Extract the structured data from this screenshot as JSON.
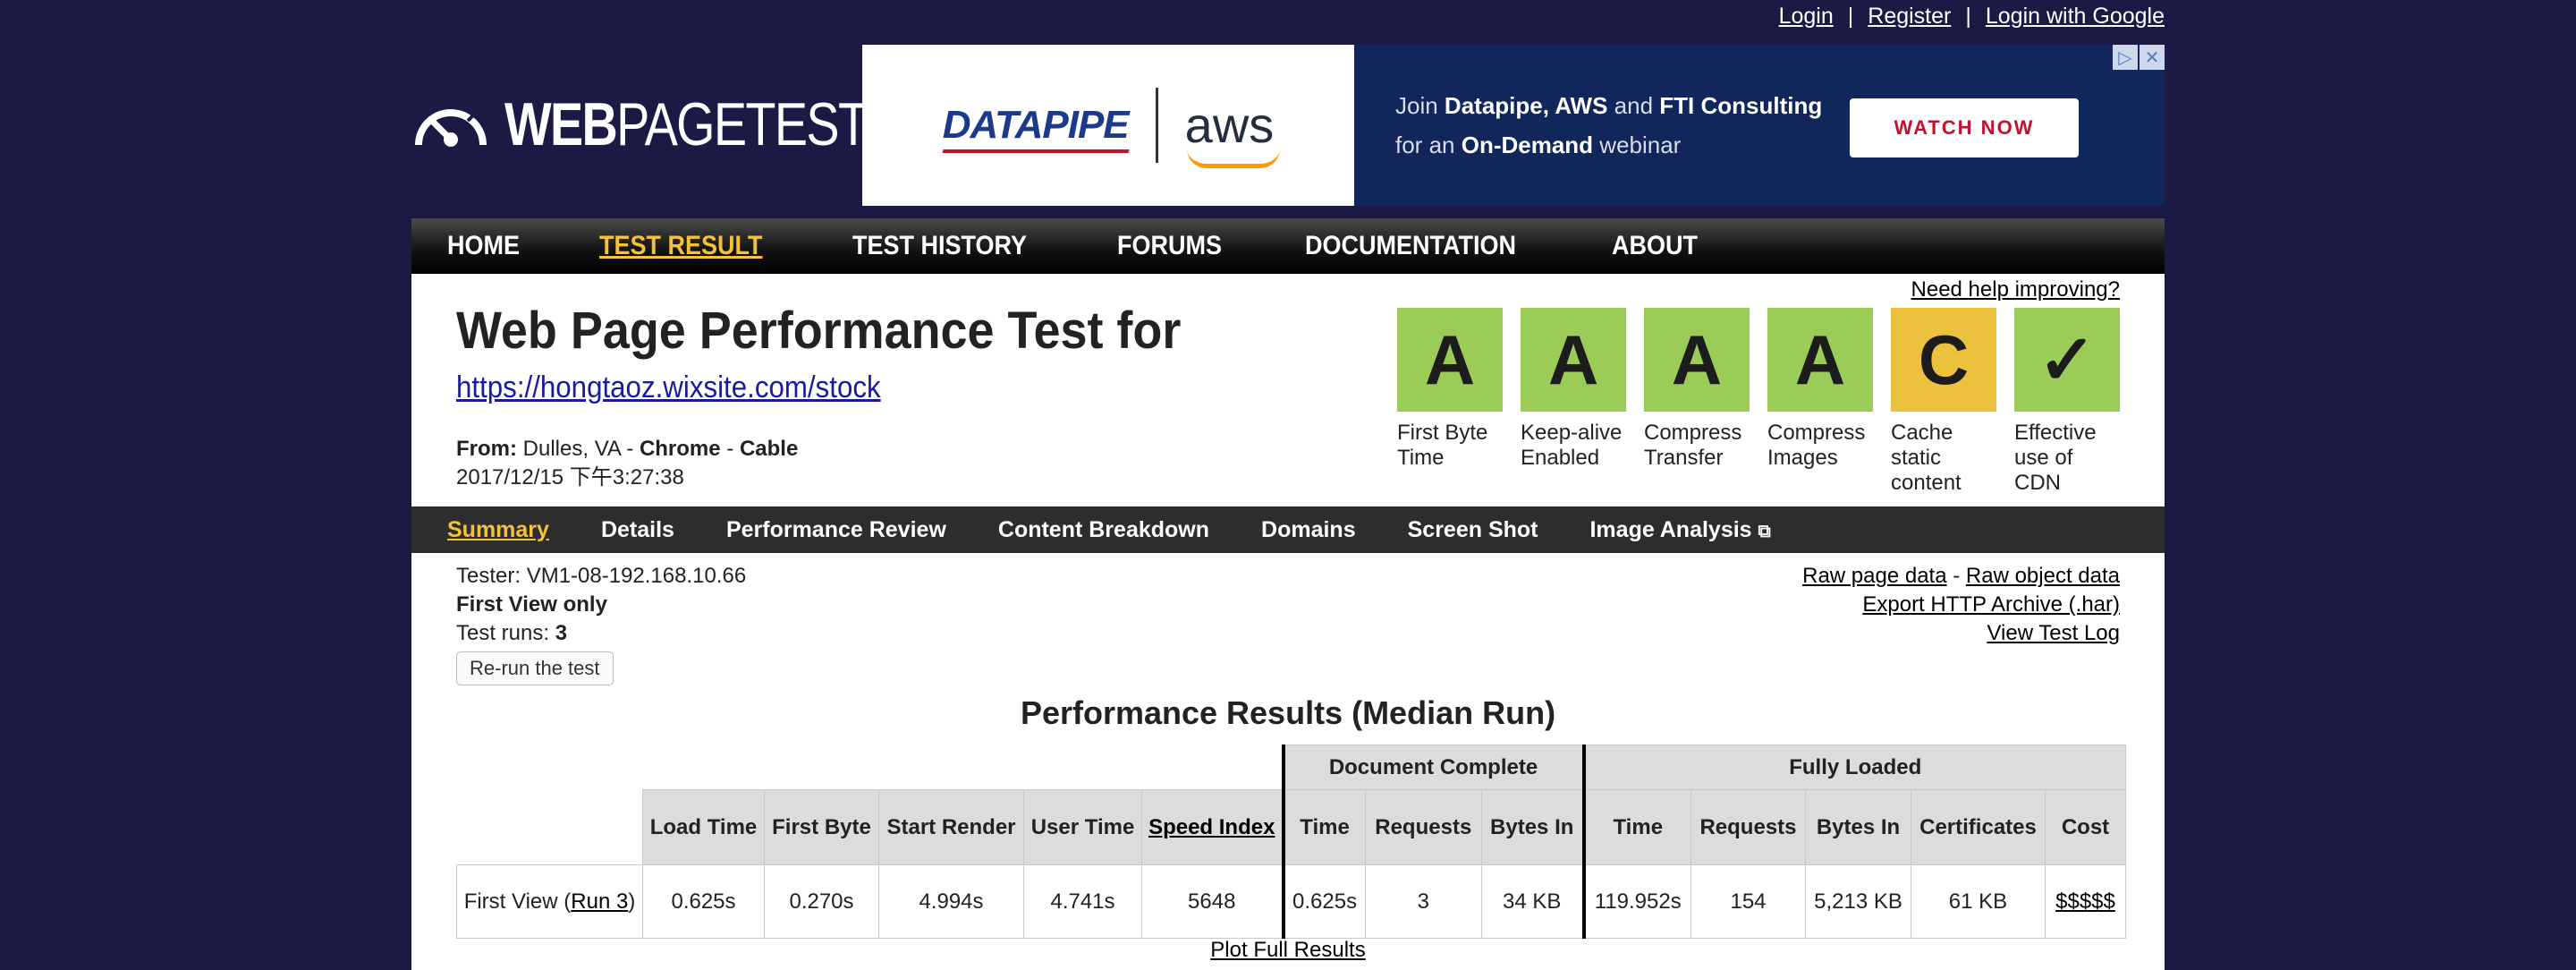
{
  "auth": {
    "login": "Login",
    "register": "Register",
    "login_google": "Login with Google",
    "sep": "|"
  },
  "logo": {
    "bold": "WEB",
    "thin": "PAGETEST"
  },
  "ad": {
    "brand1": "DATAPIPE",
    "brand2": "aws",
    "line1_pre": "Join ",
    "line1_b1": "Datapipe, AWS",
    "line1_mid": " and ",
    "line1_b2": "FTI Consulting",
    "line2_pre": "for an ",
    "line2_b": "On-Demand",
    "line2_post": " webinar",
    "cta": "WATCH NOW"
  },
  "nav": [
    "HOME",
    "TEST RESULT",
    "TEST HISTORY",
    "FORUMS",
    "DOCUMENTATION",
    "ABOUT"
  ],
  "nav_active": "TEST RESULT",
  "title": "Web Page Performance Test for",
  "url": "https://hongtaoz.wixsite.com/stock",
  "from": {
    "label": "From:",
    "location": " Dulles, VA - ",
    "browser": "Chrome",
    "dash": " - ",
    "conn": "Cable",
    "date": "2017/12/15 下午3:27:38"
  },
  "help": "Need help improving?",
  "grades": [
    {
      "grade": "A",
      "label": "First Byte Time",
      "color": "#9bcc57"
    },
    {
      "grade": "A",
      "label": "Keep-alive Enabled",
      "color": "#9bcc57"
    },
    {
      "grade": "A",
      "label": "Compress Transfer",
      "color": "#9bcc57"
    },
    {
      "grade": "A",
      "label": "Compress Images",
      "color": "#9bcc57"
    },
    {
      "grade": "C",
      "label": "Cache static content",
      "color": "#ecc13e"
    },
    {
      "grade": "✓",
      "label": "Effective use of CDN",
      "color": "#9bcc57"
    }
  ],
  "subnav": [
    "Summary",
    "Details",
    "Performance Review",
    "Content Breakdown",
    "Domains",
    "Screen Shot",
    "Image Analysis"
  ],
  "meta": {
    "tester": "Tester: VM1-08-192.168.10.66",
    "view": "First View only",
    "runs_label": "Test runs: ",
    "runs": "3",
    "rerun": "Re-run the test"
  },
  "rawlinks": {
    "raw_page": "Raw page data",
    "dash": " - ",
    "raw_object": "Raw object data",
    "har": "Export HTTP Archive (.har)",
    "log": "View Test Log"
  },
  "results": {
    "title": "Performance Results (Median Run)",
    "group_doc": "Document Complete",
    "group_full": "Fully Loaded",
    "headers": {
      "load": "Load Time",
      "first_byte": "First Byte",
      "start_render": "Start Render",
      "user_time": "User Time",
      "speed_index": "Speed Index",
      "doc_time": "Time",
      "doc_requests": "Requests",
      "doc_bytes": "Bytes In",
      "full_time": "Time",
      "full_requests": "Requests",
      "full_bytes": "Bytes In",
      "certs": "Certificates",
      "cost": "Cost"
    },
    "row": {
      "label_pre": "First View (",
      "run_link": "Run 3",
      "label_post": ")",
      "load": "0.625s",
      "first_byte": "0.270s",
      "start_render": "4.994s",
      "user_time": "4.741s",
      "speed_index": "5648",
      "doc_time": "0.625s",
      "doc_requests": "3",
      "doc_bytes": "34 KB",
      "full_time": "119.952s",
      "full_requests": "154",
      "full_bytes": "5,213 KB",
      "certs": "61 KB",
      "cost": "$$$$$"
    },
    "plot": "Plot Full Results"
  }
}
